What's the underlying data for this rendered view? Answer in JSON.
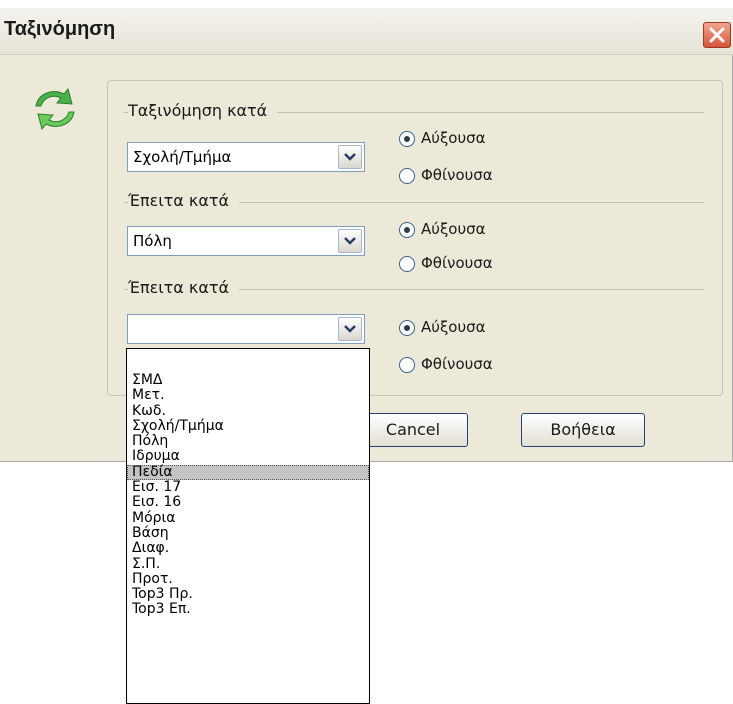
{
  "window": {
    "title": "Ταξινόμηση",
    "close_icon": "close-icon"
  },
  "icon": {
    "name": "refresh-icon",
    "colors": [
      "#3fa83c",
      "#7dd86a"
    ]
  },
  "sections": [
    {
      "label": "Ταξινόμηση κατά",
      "combo_value": "Σχολή/Τμήμα",
      "ascending": "Αύξουσα",
      "descending": "Φθίνουσα",
      "selected": "ascending"
    },
    {
      "label": "Έπειτα κατά",
      "combo_value": "Πόλη",
      "ascending": "Αύξουσα",
      "descending": "Φθίνουσα",
      "selected": "ascending"
    },
    {
      "label": "Έπειτα κατά",
      "combo_value": "",
      "ascending": "Αύξουσα",
      "descending": "Φθίνουσα",
      "selected": "ascending"
    }
  ],
  "buttons": {
    "cancel": "Cancel",
    "help": "Βοήθεια"
  },
  "dropdown": {
    "items": [
      "",
      "ΣΜΔ",
      "Μετ.",
      "Κωδ.",
      "Σχολή/Τμήμα",
      "Πόλη",
      "Ιδρυμα",
      "Πεδία",
      "Εισ. 17",
      "Εισ. 16",
      "Μόρια",
      "Βάση",
      "Διαφ.",
      "Σ.Π.",
      "Προτ.",
      "Top3 Πρ.",
      "Top3 Επ."
    ],
    "selected_index": 7
  },
  "colors": {
    "dialog_bg": "#ece9d8",
    "border_blue": "#7f9db9",
    "highlight": "#c4c4c4"
  }
}
